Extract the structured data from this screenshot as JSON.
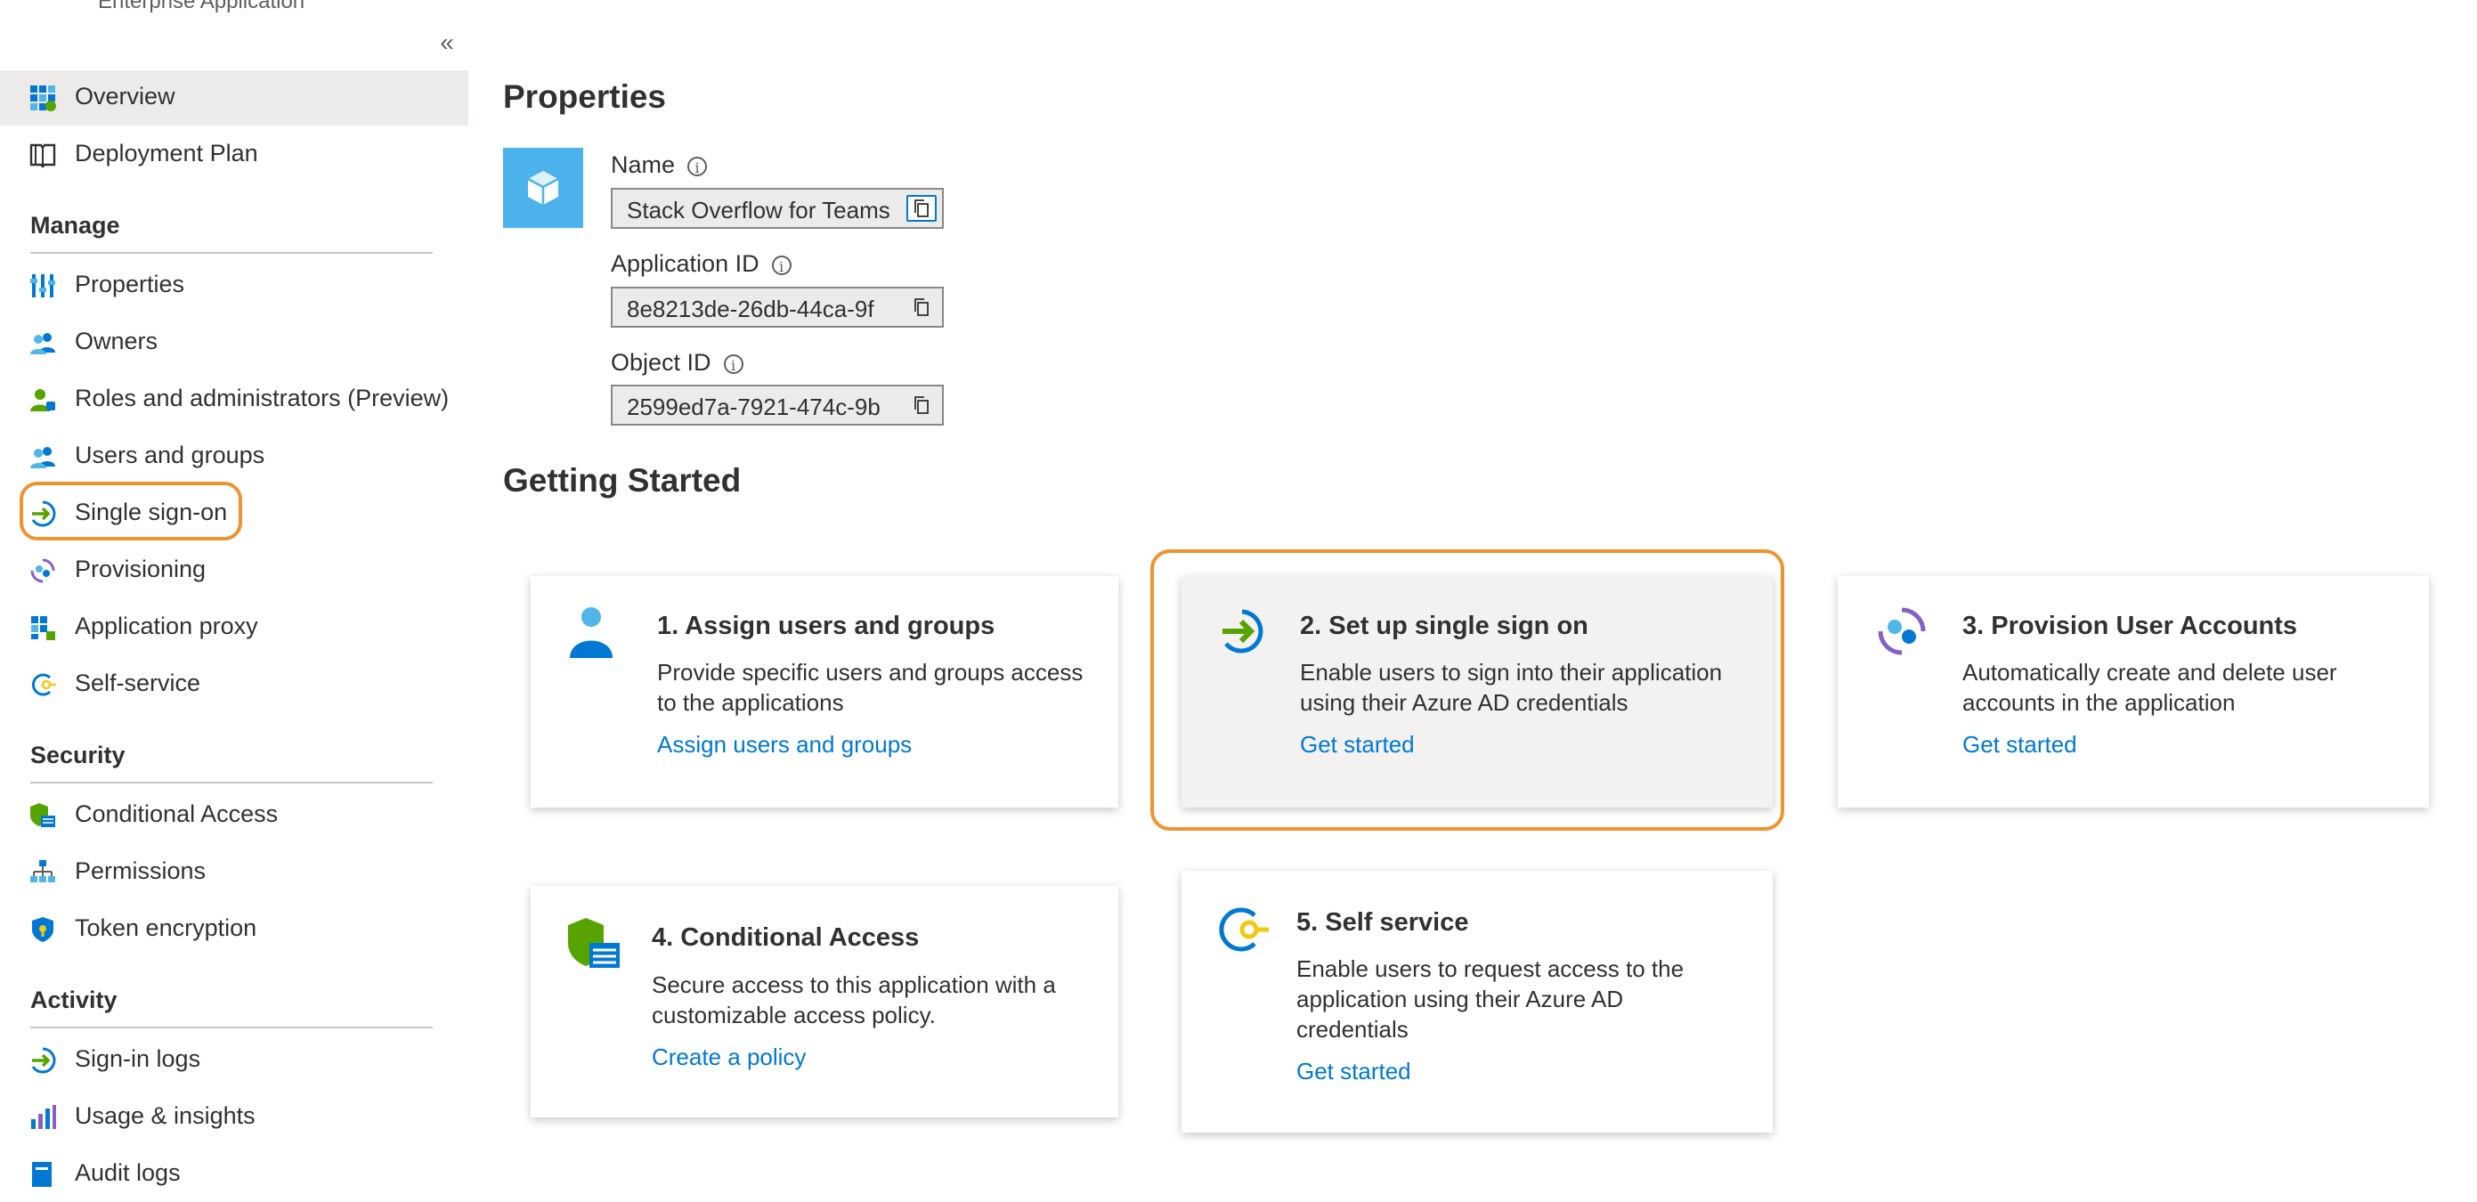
{
  "sidebar": {
    "caption": "Enterprise Application",
    "collapse_glyph": "«",
    "top_items": [
      {
        "label": "Overview",
        "icon": "grid-icon"
      },
      {
        "label": "Deployment Plan",
        "icon": "book-icon"
      }
    ],
    "sections": [
      {
        "title": "Manage",
        "items": [
          {
            "label": "Properties",
            "icon": "properties-icon"
          },
          {
            "label": "Owners",
            "icon": "users-icon"
          },
          {
            "label": "Roles and administrators (Preview)",
            "icon": "user-admin-icon"
          },
          {
            "label": "Users and groups",
            "icon": "users-icon"
          },
          {
            "label": "Single sign-on",
            "icon": "sso-arrow-icon"
          },
          {
            "label": "Provisioning",
            "icon": "provisioning-icon"
          },
          {
            "label": "Application proxy",
            "icon": "app-proxy-icon"
          },
          {
            "label": "Self-service",
            "icon": "self-service-icon"
          }
        ]
      },
      {
        "title": "Security",
        "items": [
          {
            "label": "Conditional Access",
            "icon": "conditional-access-icon"
          },
          {
            "label": "Permissions",
            "icon": "permissions-icon"
          },
          {
            "label": "Token encryption",
            "icon": "shield-icon"
          }
        ]
      },
      {
        "title": "Activity",
        "items": [
          {
            "label": "Sign-in logs",
            "icon": "sso-arrow-icon"
          },
          {
            "label": "Usage & insights",
            "icon": "chart-icon"
          },
          {
            "label": "Audit logs",
            "icon": "log-icon"
          }
        ]
      }
    ]
  },
  "properties": {
    "heading": "Properties",
    "fields": [
      {
        "label": "Name",
        "value": "Stack Overflow for Teams"
      },
      {
        "label": "Application ID",
        "value": "8e8213de-26db-44ca-9f"
      },
      {
        "label": "Object ID",
        "value": "2599ed7a-7921-474c-9b"
      }
    ],
    "info_glyph": "i"
  },
  "getting_started": {
    "heading": "Getting Started",
    "cards": [
      {
        "title": "1. Assign users and groups",
        "desc": "Provide specific users and groups access to the applications",
        "link": "Assign users and groups",
        "icon": "user-icon"
      },
      {
        "title": "2. Set up single sign on",
        "desc": "Enable users to sign into their application using their Azure AD credentials",
        "link": "Get started",
        "icon": "sso-arrow-icon"
      },
      {
        "title": "3. Provision User Accounts",
        "desc": "Automatically create and delete user accounts in the application",
        "link": "Get started",
        "icon": "provisioning-icon"
      },
      {
        "title": "4. Conditional Access",
        "desc": "Secure access to this application with a customizable access policy.",
        "link": "Create a policy",
        "icon": "conditional-access-icon"
      },
      {
        "title": "5. Self service",
        "desc": "Enable users to request access to the application using their Azure AD credentials",
        "link": "Get started",
        "icon": "self-service-icon"
      }
    ]
  },
  "colors": {
    "highlight": "#f0922f",
    "link": "#0078d4",
    "active_bg": "#edebe9"
  }
}
